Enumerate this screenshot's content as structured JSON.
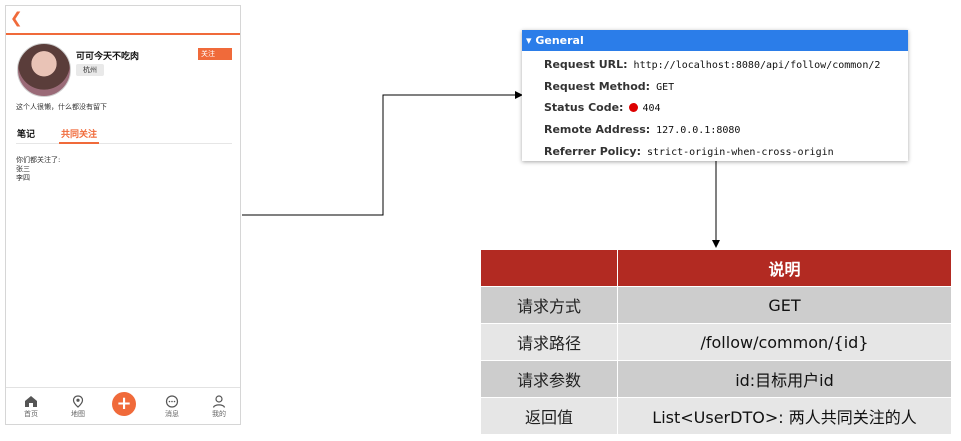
{
  "phone": {
    "back_icon": "chevron-left-icon",
    "user_name": "可可今天不吃肉",
    "city": "杭州",
    "follow_button": "关注",
    "bio": "这个人很懒，什么都没有留下",
    "tabs": [
      "笔记",
      "共同关注"
    ],
    "content_lines": [
      "你们都关注了:",
      "张三",
      "李四"
    ],
    "bottom_nav": [
      {
        "label": "首页",
        "icon": "home-icon"
      },
      {
        "label": "地图",
        "icon": "map-pin-icon"
      },
      {
        "label": "",
        "icon": "plus-icon"
      },
      {
        "label": "消息",
        "icon": "message-icon"
      },
      {
        "label": "我的",
        "icon": "user-icon"
      }
    ]
  },
  "devtools": {
    "header": "▾ General",
    "rows": [
      {
        "label": "Request URL:",
        "value": "http://localhost:8080/api/follow/common/2"
      },
      {
        "label": "Request Method:",
        "value": "GET"
      },
      {
        "label": "Status Code:",
        "value": "404"
      },
      {
        "label": "Remote Address:",
        "value": "127.0.0.1:8080"
      },
      {
        "label": "Referrer Policy:",
        "value": "strict-origin-when-cross-origin"
      }
    ],
    "status_color": "#d00000"
  },
  "table": {
    "header": [
      "",
      "说明"
    ],
    "rows": [
      [
        "请求方式",
        "GET"
      ],
      [
        "请求路径",
        "/follow/common/{id}"
      ],
      [
        "请求参数",
        "id:目标用户id"
      ],
      [
        "返回值",
        "List<UserDTO>: 两人共同关注的人"
      ]
    ],
    "header_color": "#b22a22"
  }
}
